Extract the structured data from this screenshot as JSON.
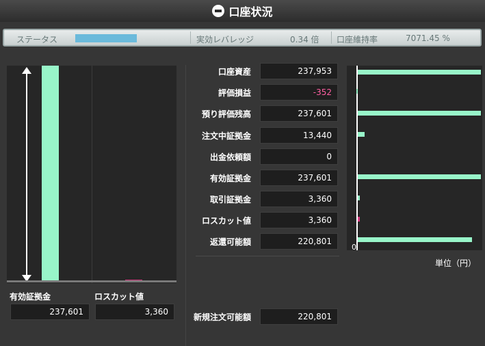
{
  "title": "口座状況",
  "status": {
    "label": "ステータス",
    "leverage_label": "実効レバレッジ",
    "leverage_value": "0.34 倍",
    "margin_ratio_label": "口座維持率",
    "margin_ratio_value": "7071.45 %"
  },
  "left_chart": {
    "bar1_label": "有効証拠金",
    "bar1_value": "237,601",
    "bar1_fraction": 1.0,
    "bar2_label": "ロスカット値",
    "bar2_value": "3,360",
    "bar2_fraction": 0.014
  },
  "rows": [
    {
      "label": "口座資産",
      "value": "237,953"
    },
    {
      "label": "評価損益",
      "value": "-352",
      "negative": true
    },
    {
      "label": "預り評価残高",
      "value": "237,601"
    },
    {
      "label": "注文中証拠金",
      "value": "13,440"
    },
    {
      "label": "出金依頼額",
      "value": "0"
    },
    {
      "label": "有効証拠金",
      "value": "237,601"
    },
    {
      "label": "取引証拠金",
      "value": "3,360"
    },
    {
      "label": "ロスカット値",
      "value": "3,360"
    },
    {
      "label": "返還可能額",
      "value": "220,801"
    }
  ],
  "new_order": {
    "label": "新規注文可能額",
    "value": "220,801"
  },
  "chart_data": {
    "type": "bar",
    "orientation": "horizontal",
    "categories": [
      "口座資産",
      "評価損益",
      "預り評価残高",
      "注文中証拠金",
      "出金依頼額",
      "有効証拠金",
      "取引証拠金",
      "ロスカット値",
      "返還可能額"
    ],
    "values": [
      237953,
      -352,
      237601,
      13440,
      0,
      237601,
      3360,
      3360,
      220801
    ],
    "xmin": 0,
    "xlabel": "0",
    "unit_label": "単位（円）"
  },
  "colors": {
    "bar": "#98f5c9",
    "losscut": "#d93b82",
    "negative": "#ff5fa2",
    "status_meter": "#6bbadb"
  },
  "icons": {
    "title": "account-icon"
  }
}
